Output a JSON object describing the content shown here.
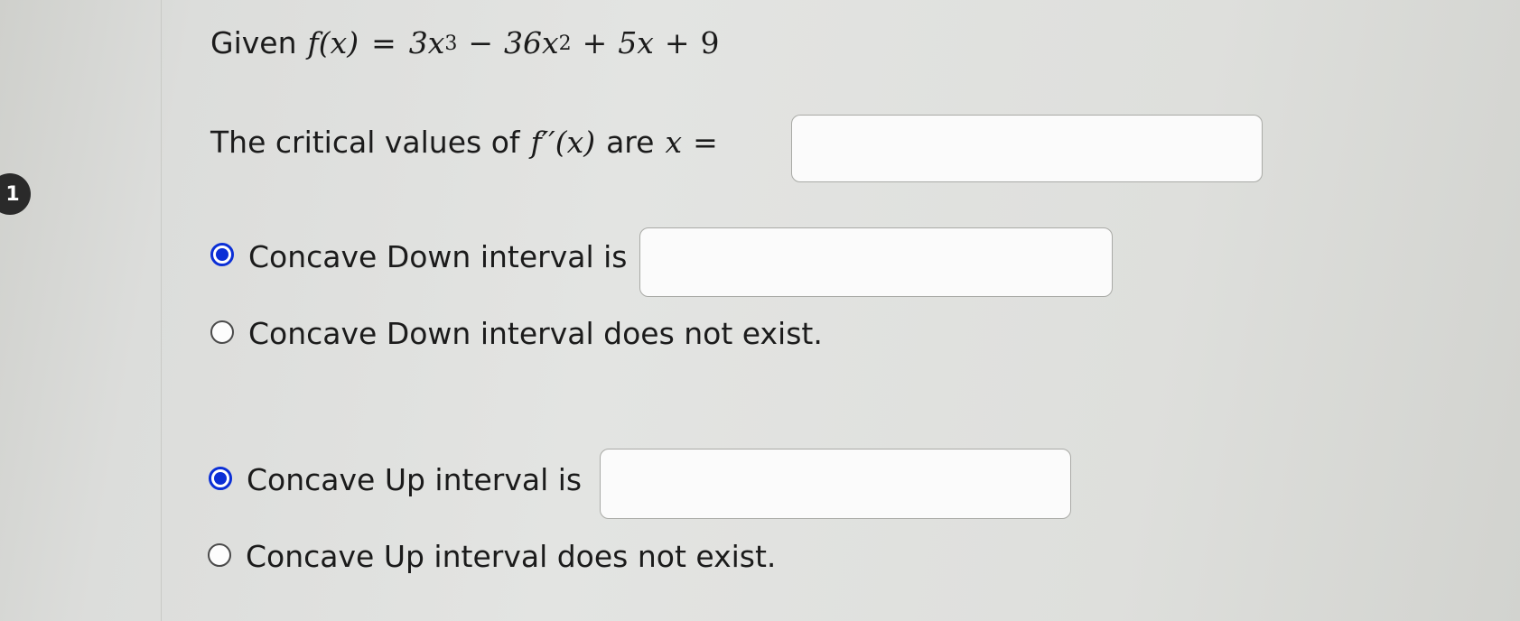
{
  "question": {
    "number": "1",
    "given_prefix": "Given",
    "function_lhs": "f(x)",
    "eq": "=",
    "term1": "3x",
    "term1_exp": "3",
    "minus": "−",
    "term2": "36x",
    "term2_exp": "2",
    "plus1": "+",
    "term3": "5x",
    "plus2": "+",
    "term4": "9",
    "critical_prefix": "The critical values of",
    "second_derivative": "f′′(x)",
    "critical_mid": "are",
    "critical_var": "x",
    "critical_eq": "=",
    "critical_answer": ""
  },
  "concave_down": {
    "selected_option": "interval",
    "interval_label": "Concave Down interval is",
    "interval_answer": "",
    "none_label": "Concave Down interval does not exist."
  },
  "concave_up": {
    "selected_option": "interval",
    "interval_label": "Concave Up interval is",
    "interval_answer": "",
    "none_label": "Concave Up interval does not exist."
  },
  "colors": {
    "radio_selected": "#0b2fd6",
    "background": "#e0e1df"
  }
}
